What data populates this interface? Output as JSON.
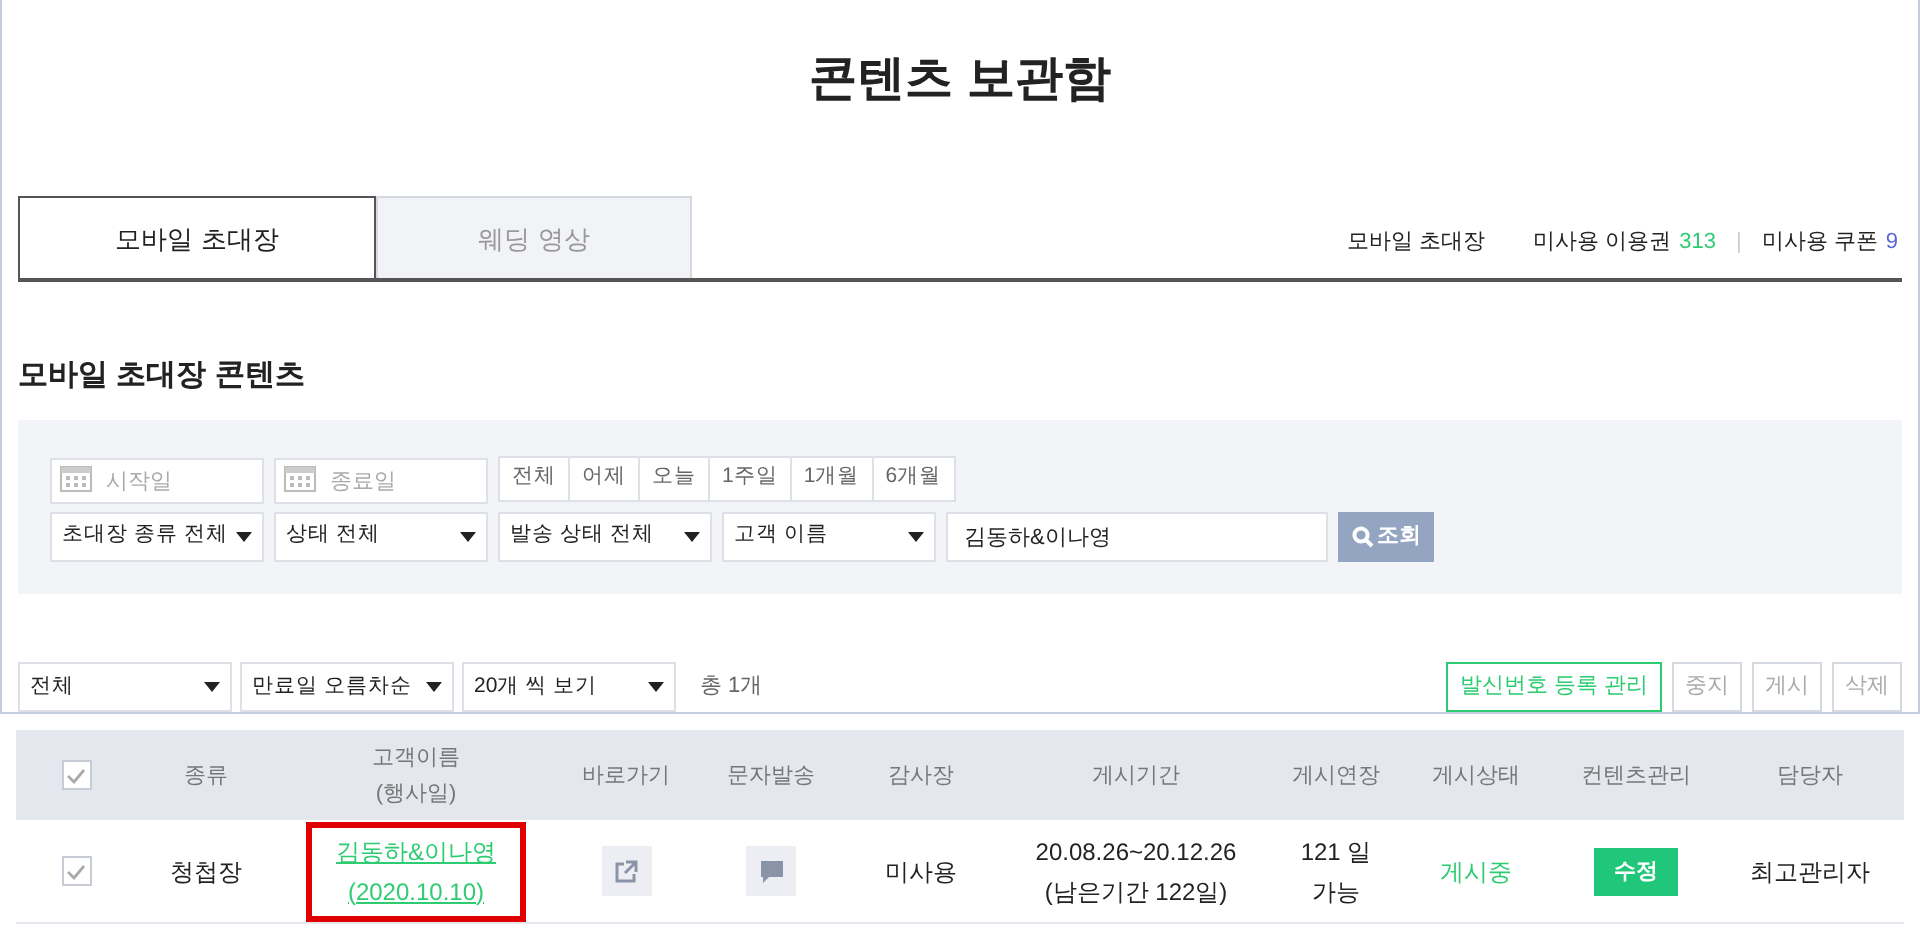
{
  "title": "콘텐츠 보관함",
  "tabs": [
    {
      "label": "모바일 초대장",
      "selected": true
    },
    {
      "label": "웨딩 영상",
      "selected": false
    }
  ],
  "summary": [
    {
      "label": "모바일 초대장"
    },
    {
      "label": "미사용 이용권",
      "count": "313",
      "color": "#2ecc71"
    },
    {
      "label": "미사용 쿠폰",
      "count": "9",
      "color": "#5b6bd6"
    }
  ],
  "summary_separator": "|",
  "section_title": "모바일 초대장 콘텐츠",
  "filters": {
    "date_fields": [
      {
        "placeholder": "시작일"
      },
      {
        "placeholder": "종료일"
      }
    ],
    "periods": [
      "전체",
      "어제",
      "오늘",
      "1주일",
      "1개월",
      "6개월"
    ],
    "selects": [
      "초대장 종류 전체",
      "상태 전체",
      "발송 상태 전체",
      "고객 이름"
    ],
    "search": {
      "value": "김동하&이나영"
    },
    "search_button": "조회"
  },
  "list_controls": {
    "selects": [
      "전체",
      "만료일 오름차순",
      "20개 씩 보기"
    ],
    "total": "총 1개",
    "buttons": [
      {
        "label": "발신번호 등록 관리",
        "kind": "primary"
      },
      {
        "label": "중지",
        "kind": "plain"
      },
      {
        "label": "게시",
        "kind": "plain"
      },
      {
        "label": "삭제",
        "kind": "plain"
      }
    ]
  },
  "table": {
    "header_checkbox": {
      "checked": true
    },
    "columns": [
      [
        "종류"
      ],
      [
        "고객이름",
        "(행사일)"
      ],
      [
        "바로가기"
      ],
      [
        "문자발송"
      ],
      [
        "감사장"
      ],
      [
        "게시기간"
      ],
      [
        "게시연장"
      ],
      [
        "게시상태"
      ],
      [
        "컨텐츠관리"
      ],
      [
        "담당자"
      ]
    ],
    "rows": [
      {
        "checked": true,
        "type": "청첩장",
        "customer": "김동하&이나영",
        "event_date": "(2020.10.10)",
        "highlighted": true,
        "thank_you": "미사용",
        "period": [
          "20.08.26~20.12.26",
          "(남은기간 122일)"
        ],
        "extension": [
          "121 일",
          "가능"
        ],
        "status": "게시중",
        "action": "수정",
        "manager": "최고관리자"
      }
    ]
  }
}
